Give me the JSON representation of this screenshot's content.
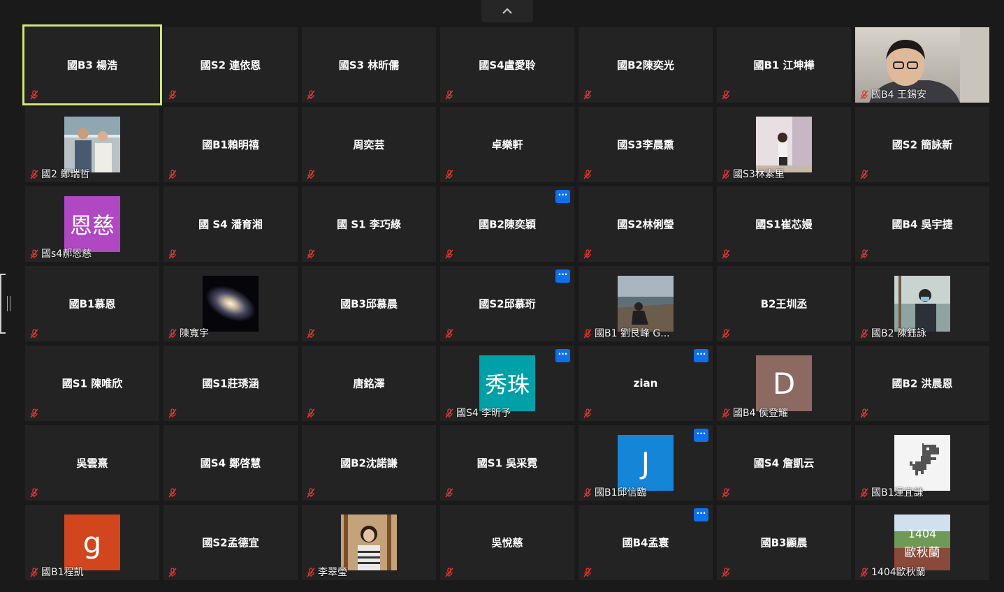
{
  "gallery": {
    "collapse_icon": "chevron-up-icon",
    "tiles": [
      {
        "name": "國B3 楊浩"
      },
      {
        "name": "國S2 連依恩"
      },
      {
        "name": "國S3 林昕儒"
      },
      {
        "name": "國S4盧愛聆"
      },
      {
        "name": "國B2陳奕光"
      },
      {
        "name": "國B1 江坤樺"
      },
      {
        "label": "國B4 王錫安"
      },
      {
        "label": "國2 鄭瑞哲"
      },
      {
        "name": "國B1賴明禧"
      },
      {
        "name": "周奕芸"
      },
      {
        "name": "卓樂軒"
      },
      {
        "name": "國S3李晨熏"
      },
      {
        "label": "國S3林素里"
      },
      {
        "name": "國S2 簡詠新"
      },
      {
        "label": "國s4郝恩慈",
        "avatar_text": "恩慈",
        "avatar_color": "#b048c4"
      },
      {
        "name": "國 S4 潘育湘"
      },
      {
        "name": "國 S1 李巧綠"
      },
      {
        "name": "國B2陳奕穎"
      },
      {
        "name": "國S2林俐瑩"
      },
      {
        "name": "國S1崔芯嫚"
      },
      {
        "name": "國B4 吳宇捷"
      },
      {
        "name": "國B1慕恩"
      },
      {
        "label": "陳寬宇"
      },
      {
        "name": "國B3邱慕晨"
      },
      {
        "name": "國S2邱慕珩"
      },
      {
        "label": "國B1 劉艮峰 G..."
      },
      {
        "name": "B2王圳丞"
      },
      {
        "label": "國B2  陳鈺詠"
      },
      {
        "name": "國S1 陳唯欣"
      },
      {
        "name": "國S1莊琇涵"
      },
      {
        "name": "唐銘澤"
      },
      {
        "label": "國S4 李昕予",
        "avatar_text": "秀珠",
        "avatar_color": "#00a0a8"
      },
      {
        "name": "zian"
      },
      {
        "label": "國B4 侯登耀",
        "avatar_text": "D",
        "avatar_color": "#8c6a62"
      },
      {
        "name": "國B2 洪晨恩"
      },
      {
        "name": "吳雲熹"
      },
      {
        "name": "國S4 鄭啓慧"
      },
      {
        "name": "國B2沈諾謙"
      },
      {
        "name": "國S1 吳采霓"
      },
      {
        "label": "國B1邱信臨",
        "avatar_text": "J",
        "avatar_color": "#1585d8"
      },
      {
        "name": "國S4 詹凱云"
      },
      {
        "label": "國B1運宜謙"
      },
      {
        "label": "國B1程凱",
        "avatar_text": "g",
        "avatar_color": "#d2461e"
      },
      {
        "name": "國S2孟德宜"
      },
      {
        "label": "李翠瑩"
      },
      {
        "name": "吳悅慈"
      },
      {
        "name": "國B4孟寰"
      },
      {
        "name": "國B3顯晨"
      },
      {
        "label": "1404歐秋蘭",
        "pic_text_1": "1404",
        "pic_text_2": "歐秋蘭"
      }
    ]
  },
  "colors": {
    "active_speaker_border": "#cfe67a",
    "tile_bg": "#232323",
    "more_button": "#0e71eb",
    "muted_icon": "#e0382f"
  }
}
